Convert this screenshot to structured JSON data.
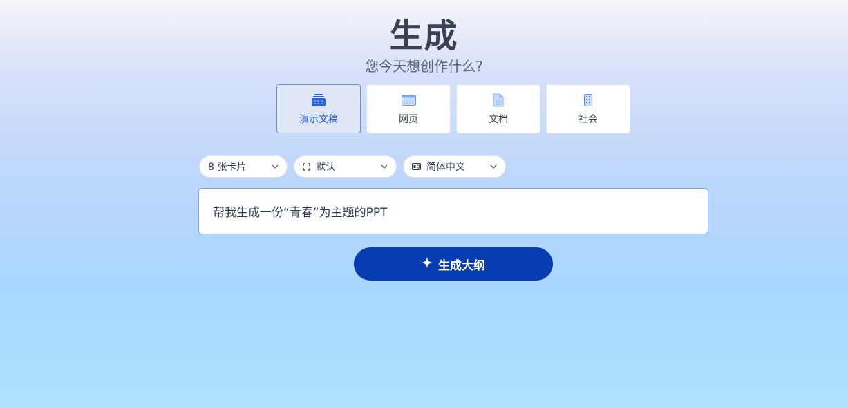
{
  "header": {
    "title": "生成",
    "subtitle": "您今天想创作什么?"
  },
  "types": [
    {
      "label": "演示文稿",
      "icon": "presentation-stack-icon",
      "selected": true
    },
    {
      "label": "网页",
      "icon": "webpage-icon",
      "selected": false
    },
    {
      "label": "文档",
      "icon": "document-icon",
      "selected": false
    },
    {
      "label": "社会",
      "icon": "social-phone-icon",
      "selected": false
    }
  ],
  "options": {
    "cards": {
      "value": "8 张卡片",
      "icon": "chevron-down-icon"
    },
    "format": {
      "value": "默认",
      "icon": "frame-icon"
    },
    "language": {
      "value": "简体中文",
      "icon": "language-icon"
    }
  },
  "prompt": {
    "value": "帮我生成一份“青春”为主题的PPT"
  },
  "generate_button": {
    "label": "生成大纲",
    "icon": "sparkle-icon"
  },
  "colors": {
    "accent": "#073db1",
    "selected_label": "#1f4fc2",
    "selected_bg": "#dfe7f6"
  }
}
